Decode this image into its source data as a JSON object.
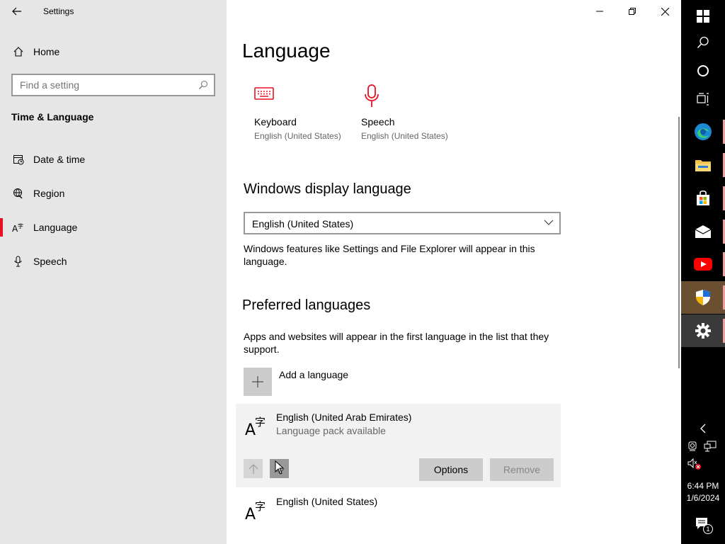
{
  "app": {
    "title": "Settings"
  },
  "sidebar": {
    "home_label": "Home",
    "search_placeholder": "Find a setting",
    "section_title": "Time & Language",
    "items": [
      {
        "label": "Date & time",
        "icon": "calendar-icon"
      },
      {
        "label": "Region",
        "icon": "globe-icon"
      },
      {
        "label": "Language",
        "icon": "language-icon",
        "active": true
      },
      {
        "label": "Speech",
        "icon": "microphone-icon"
      }
    ]
  },
  "main": {
    "title": "Language",
    "tiles": [
      {
        "name": "Keyboard",
        "sub": "English (United States)",
        "icon": "keyboard-icon"
      },
      {
        "name": "Speech",
        "sub": "English (United States)",
        "icon": "microphone-icon"
      }
    ],
    "display_language": {
      "heading": "Windows display language",
      "selected": "English (United States)",
      "description": "Windows features like Settings and File Explorer will appear in this language."
    },
    "preferred": {
      "heading": "Preferred languages",
      "description": "Apps and websites will appear in the first language in the list that they support.",
      "add_label": "Add a language",
      "languages": [
        {
          "name": "English (United Arab Emirates)",
          "sub": "Language pack available"
        },
        {
          "name": "English (United States)",
          "sub": ""
        }
      ],
      "options_label": "Options",
      "remove_label": "Remove"
    }
  },
  "taskbar": {
    "time": "6:44 PM",
    "date": "1/6/2024",
    "notification_count": "1"
  },
  "colors": {
    "accent": "#e81123",
    "sidebar_bg": "#e6e6e6",
    "taskbar_bg": "#000000"
  }
}
